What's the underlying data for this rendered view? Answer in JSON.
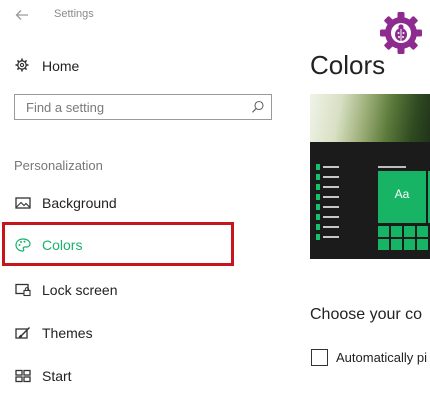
{
  "window": {
    "title": "Settings"
  },
  "sidebar": {
    "home_label": "Home",
    "search": {
      "placeholder": "Find a setting"
    },
    "section_label": "Personalization",
    "items": [
      {
        "label": "Background",
        "icon": "picture-icon"
      },
      {
        "label": "Colors",
        "icon": "palette-icon",
        "selected": true
      },
      {
        "label": "Lock screen",
        "icon": "lock-screen-icon"
      },
      {
        "label": "Themes",
        "icon": "themes-icon"
      },
      {
        "label": "Start",
        "icon": "start-icon"
      }
    ]
  },
  "main": {
    "title": "Colors",
    "preview": {
      "sample_text": "Aa"
    },
    "choose_heading": "Choose your co",
    "auto_checkbox_label": "Automatically pi",
    "auto_checkbox_checked": false
  },
  "colors": {
    "accent": "#18b26a",
    "highlight_box": "#c4161c",
    "logo": "#8e2b8f"
  }
}
